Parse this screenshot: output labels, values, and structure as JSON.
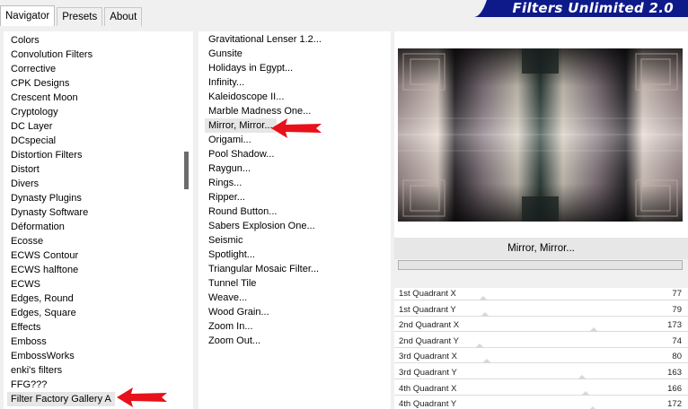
{
  "tabs": [
    {
      "label": "Navigator",
      "active": true
    },
    {
      "label": "Presets",
      "active": false
    },
    {
      "label": "About",
      "active": false
    }
  ],
  "banner": {
    "title": "Filters Unlimited 2.0",
    "color": "#0e1a8a"
  },
  "categories": [
    "Colors",
    "Convolution Filters",
    "Corrective",
    "CPK Designs",
    "Crescent Moon",
    "Cryptology",
    "DC Layer",
    "DCspecial",
    "Distortion Filters",
    "Distort",
    "Divers",
    "Dynasty Plugins",
    "Dynasty Software",
    "Déformation",
    "Ecosse",
    "ECWS Contour",
    "ECWS halftone",
    "ECWS",
    "Edges, Round",
    "Edges, Square",
    "Effects",
    "Emboss",
    "EmbossWorks",
    "enki's filters",
    "FFG???",
    "Filter Factory Gallery A"
  ],
  "selected_category": "Filter Factory Gallery A",
  "filters": [
    "Gravitational Lenser 1.2...",
    "Gunsite",
    "Holidays in Egypt...",
    "Infinity...",
    "Kaleidoscope II...",
    "Marble Madness One...",
    "Mirror, Mirror...",
    "Origami...",
    "Pool Shadow...",
    "Raygun...",
    "Rings...",
    "Ripper...",
    "Round Button...",
    "Sabers Explosion One...",
    "Seismic",
    "Spotlight...",
    "Triangular Mosaic Filter...",
    "Tunnel Tile",
    "Weave...",
    "Wood Grain...",
    "Zoom In...",
    "Zoom Out..."
  ],
  "selected_filter": "Mirror, Mirror...",
  "preview": {
    "filter_name": "Mirror, Mirror..."
  },
  "params": [
    {
      "label": "1st Quadrant X",
      "value": 77
    },
    {
      "label": "1st Quadrant Y",
      "value": 79
    },
    {
      "label": "2nd Quadrant X",
      "value": 173
    },
    {
      "label": "2nd Quadrant Y",
      "value": 74
    },
    {
      "label": "3rd Quadrant X",
      "value": 80
    },
    {
      "label": "3rd Quadrant Y",
      "value": 163
    },
    {
      "label": "4th Quadrant X",
      "value": 166
    },
    {
      "label": "4th Quadrant Y",
      "value": 172
    }
  ],
  "param_max": 255,
  "annotation_arrow_color": "#e8101a"
}
